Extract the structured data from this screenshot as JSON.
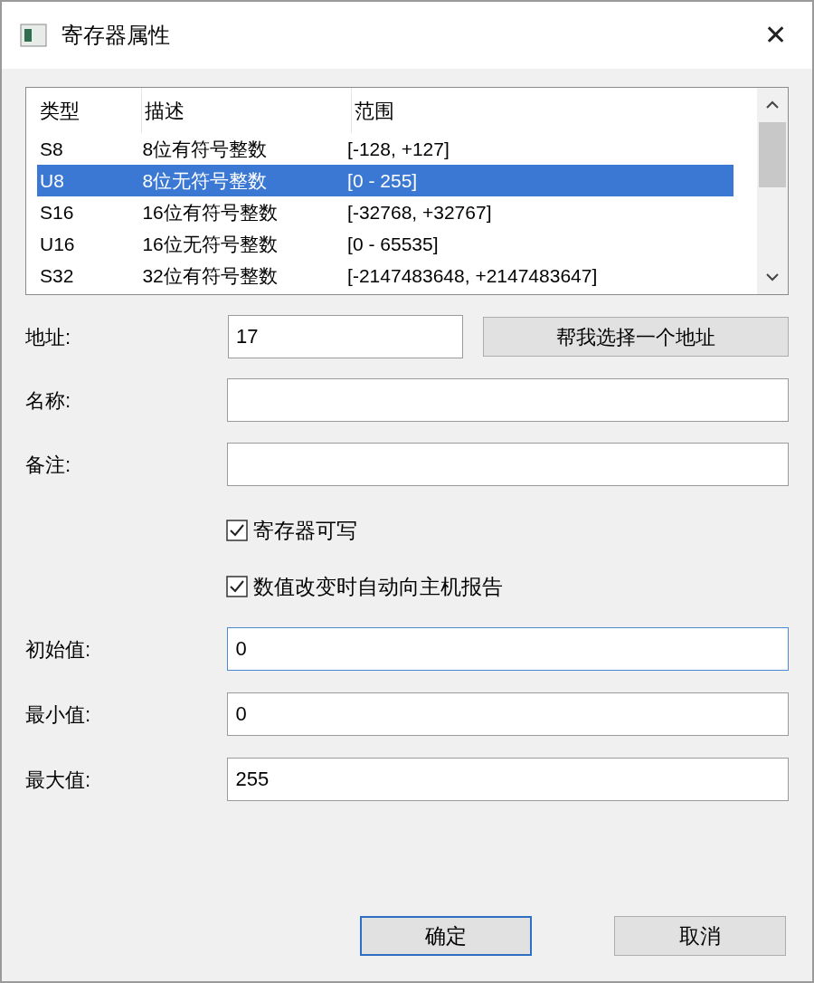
{
  "window": {
    "title": "寄存器属性",
    "close": "✕"
  },
  "list": {
    "columns": [
      "类型",
      "描述",
      "范围"
    ],
    "rows": [
      {
        "cells": [
          "S8",
          "8位有符号整数",
          "[-128, +127]"
        ],
        "selected": false
      },
      {
        "cells": [
          "U8",
          "8位无符号整数",
          "[0 - 255]"
        ],
        "selected": true
      },
      {
        "cells": [
          "S16",
          "16位有符号整数",
          "[-32768, +32767]"
        ],
        "selected": false
      },
      {
        "cells": [
          "U16",
          "16位无符号整数",
          "[0 - 65535]"
        ],
        "selected": false
      },
      {
        "cells": [
          "S32",
          "32位有符号整数",
          "[-2147483648, +2147483647]"
        ],
        "selected": false
      }
    ]
  },
  "address": {
    "label": "地址:",
    "value": "17",
    "button": "帮我选择一个地址"
  },
  "fields_top": [
    {
      "label": "名称:",
      "focused": false
    },
    {
      "label": "备注:",
      "focused": false
    }
  ],
  "checkboxes": [
    {
      "label": "寄存器可写",
      "checked": true
    },
    {
      "label": "数值改变时自动向主机报告",
      "checked": true
    }
  ],
  "fields_bottom": [
    {
      "label": "初始值:",
      "value": "0",
      "focused": true
    },
    {
      "label": "最小值:",
      "value": "0",
      "focused": false
    },
    {
      "label": "最大值:",
      "value": "255",
      "focused": false
    }
  ],
  "buttons": [
    {
      "label": "确定",
      "default": true
    },
    {
      "label": "取消",
      "default": false
    }
  ]
}
